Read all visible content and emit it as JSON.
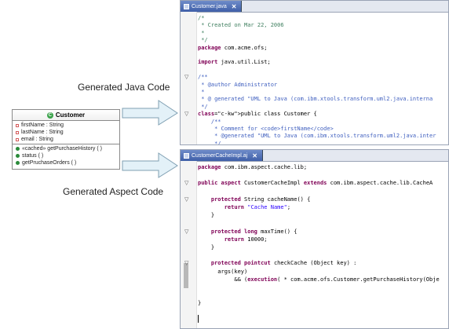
{
  "labels": {
    "java": "Generated Java Code",
    "aspect": "Generated Aspect Code"
  },
  "uml": {
    "class_name": "Customer",
    "attributes": [
      "firstName : String",
      "lastName : String",
      "email : String"
    ],
    "operations": [
      "«cached» getPurchaseHistory ( )",
      "status ( )",
      "getPruchaseOrders ( )"
    ],
    "colors": {
      "class_icon": "#3aa24a",
      "attr_icon": "#d45a5a",
      "op_icon": "#2a8a3a"
    }
  },
  "java_editor": {
    "tab_label": "Customer.java",
    "close_glyph": "✕",
    "lines": [
      {
        "text": "/*",
        "style": "c-comment"
      },
      {
        "text": " * Created on Mar 22, 2006",
        "style": "c-comment"
      },
      {
        "text": " *",
        "style": "c-comment"
      },
      {
        "text": " */",
        "style": "c-comment"
      },
      {
        "text": "package com.acme.ofs;",
        "style": "c-plain",
        "kw": "package"
      },
      {
        "text": "",
        "style": "c-plain"
      },
      {
        "text": "import java.util.List;",
        "style": "c-plain",
        "kw": "import"
      },
      {
        "text": "",
        "style": "c-plain"
      },
      {
        "text": "/**",
        "style": "c-doc",
        "fold": true
      },
      {
        "text": " * @author Administrator",
        "style": "c-doc"
      },
      {
        "text": " *",
        "style": "c-doc"
      },
      {
        "text": " * @ generated \"UML to Java (com.ibm.xtools.transform.uml2.java.interna",
        "style": "c-doc"
      },
      {
        "text": " */",
        "style": "c-doc"
      },
      {
        "text": "public class Customer {",
        "style": "c-plain",
        "kw": "public class",
        "fold": true
      },
      {
        "text": "    /**",
        "style": "c-doc"
      },
      {
        "text": "     * Comment for <code>firstName</code>",
        "style": "c-doc"
      },
      {
        "text": "     * @generated \"UML to Java (com.ibm.xtools.transform.uml2.java.inter",
        "style": "c-doc"
      },
      {
        "text": "     */",
        "style": "c-doc"
      }
    ]
  },
  "aspect_editor": {
    "tab_label": "CustomerCacheImpl.aj",
    "close_glyph": "✕",
    "lines": [
      {
        "text": "package com.ibm.aspect.cache.lib;",
        "style": "c-plain",
        "kw": "package"
      },
      {
        "text": "",
        "style": "c-plain"
      },
      {
        "text": "public aspect CustomerCacheImpl extends com.ibm.aspect.cache.lib.CacheA",
        "style": "c-plain",
        "kw": "public aspect",
        "kw2": "extends",
        "fold": true
      },
      {
        "text": "",
        "style": "c-plain"
      },
      {
        "text": "    protected String cacheName() {",
        "style": "c-plain",
        "kw": "protected",
        "fold": true
      },
      {
        "text": "        return \"Cache Name\";",
        "style": "c-plain",
        "kw": "return",
        "str": "\"Cache Name\""
      },
      {
        "text": "    }",
        "style": "c-plain"
      },
      {
        "text": "",
        "style": "c-plain"
      },
      {
        "text": "    protected long maxTime() {",
        "style": "c-plain",
        "kw": "protected long",
        "fold": true
      },
      {
        "text": "        return 10000;",
        "style": "c-plain",
        "kw": "return"
      },
      {
        "text": "    }",
        "style": "c-plain"
      },
      {
        "text": "",
        "style": "c-plain"
      },
      {
        "text": "    protected pointcut checkCache (Object key) :",
        "style": "c-plain",
        "kw": "protected pointcut",
        "fold": true
      },
      {
        "text": "      args(key)",
        "style": "c-plain"
      },
      {
        "text": "           && (execution( * com.acme.ofs.Customer.getPurchaseHistory(Obje",
        "style": "c-plain",
        "kw": "execution"
      },
      {
        "text": "",
        "style": "c-plain"
      },
      {
        "text": "",
        "style": "c-plain"
      },
      {
        "text": "}",
        "style": "c-plain"
      }
    ]
  }
}
